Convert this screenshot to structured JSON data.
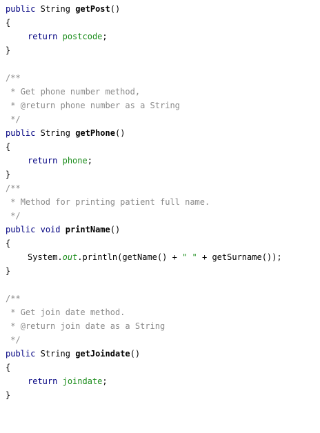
{
  "keywords": {
    "public": "public",
    "return": "return",
    "void": "void"
  },
  "types": {
    "string": "String"
  },
  "methods": [
    {
      "name": "getPost",
      "return_value": "postcode"
    },
    {
      "doc_lines": [
        "Get phone number method,",
        "phone number as a String"
      ],
      "doc_tag": "@return",
      "name": "getPhone",
      "return_value": "phone"
    },
    {
      "doc_lines": [
        "Method for printing patient full name."
      ],
      "name": "printName",
      "body": {
        "system": "System",
        "out": "out",
        "println": "println",
        "arg1": "getName",
        "plus": "+",
        "space_str": "\" \"",
        "arg2": "getSurname"
      }
    },
    {
      "doc_lines": [
        "Get join date method.",
        "join date as a String"
      ],
      "doc_tag": "@return",
      "name": "getJoindate",
      "return_value": "joindate"
    }
  ],
  "punct": {
    "parens": "()",
    "open_brace": "{",
    "close_brace": "}",
    "semicolon": ";",
    "doc_open": "/**",
    "doc_star": " *",
    "doc_close": " */"
  }
}
